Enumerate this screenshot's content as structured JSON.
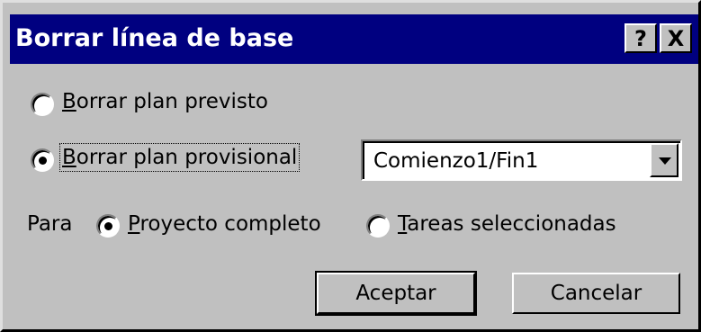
{
  "window": {
    "title": "Borrar línea de base",
    "help_label": "?",
    "close_label": "X"
  },
  "options": {
    "clear_baseline": {
      "prefix": "",
      "mnemonic": "B",
      "rest": "orrar plan previsto",
      "selected": false
    },
    "clear_interim": {
      "mnemonic": "B",
      "rest": "orrar plan provisional",
      "selected": true
    }
  },
  "interim_select": {
    "value": "Comienzo1/Fin1"
  },
  "scope": {
    "label": "Para",
    "entire_project": {
      "mnemonic": "P",
      "rest": "royecto completo",
      "selected": true
    },
    "selected_tasks": {
      "mnemonic": "T",
      "rest": "areas seleccionadas",
      "selected": false
    }
  },
  "buttons": {
    "ok_label": "Aceptar",
    "cancel_label": "Cancelar"
  },
  "colors": {
    "titlebar": "#000080",
    "face": "#c0c0c0"
  }
}
